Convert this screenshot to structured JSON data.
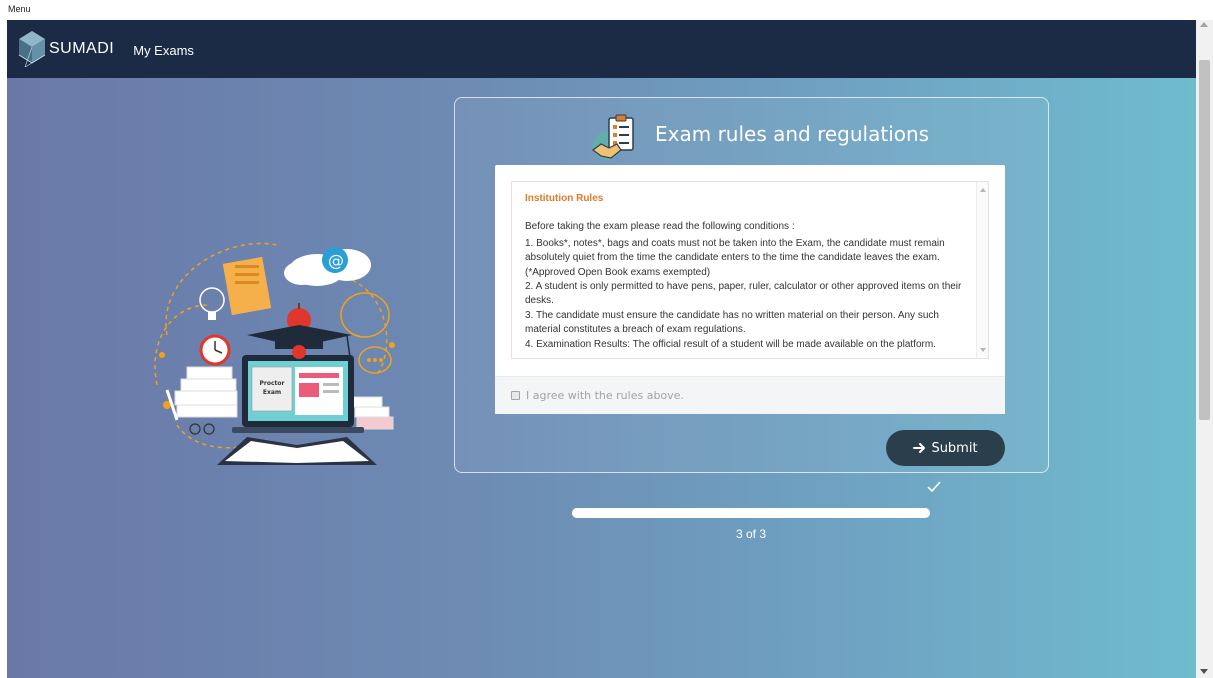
{
  "window": {
    "menu_label": "Menu"
  },
  "navbar": {
    "logo_text": "SUMADI",
    "my_exams_label": "My Exams"
  },
  "card": {
    "title": "Exam rules and regulations",
    "rules": {
      "heading": "Institution Rules",
      "intro": "Before taking the exam please read the following conditions :",
      "items": [
        "1. Books*, notes*, bags and coats must not be taken into the Exam, the candidate must remain absolutely quiet from the time the candidate enters to the time the candidate leaves the exam. (*Approved Open Book exams exempted)",
        "2. A student is only permitted to have pens, paper, ruler, calculator or other approved items on their desks.",
        "3. The candidate must ensure the candidate has no written material on their person. Any such material constitutes a breach of exam regulations.",
        "4. Examination Results: The official result of a student will be made available on the platform."
      ]
    },
    "agree_label": "I agree with the rules above.",
    "agree_checked": false,
    "submit_label": "Submit"
  },
  "progress": {
    "label": "3 of 3",
    "fraction": 1.0
  },
  "illustration": {
    "screen_text_line1": "Proctor",
    "screen_text_line2": "Exam"
  },
  "colors": {
    "navbar": "#1b2a45",
    "accent_orange": "#e07b29",
    "submit_button": "#2b3e4c",
    "background_left": "#6a78a8",
    "background_right": "#6fbccd"
  },
  "icons": {
    "logo": "sumadi-logo-icon",
    "card": "handshake-checklist-icon",
    "submit": "arrow-right-icon",
    "progress_done": "check-icon"
  }
}
